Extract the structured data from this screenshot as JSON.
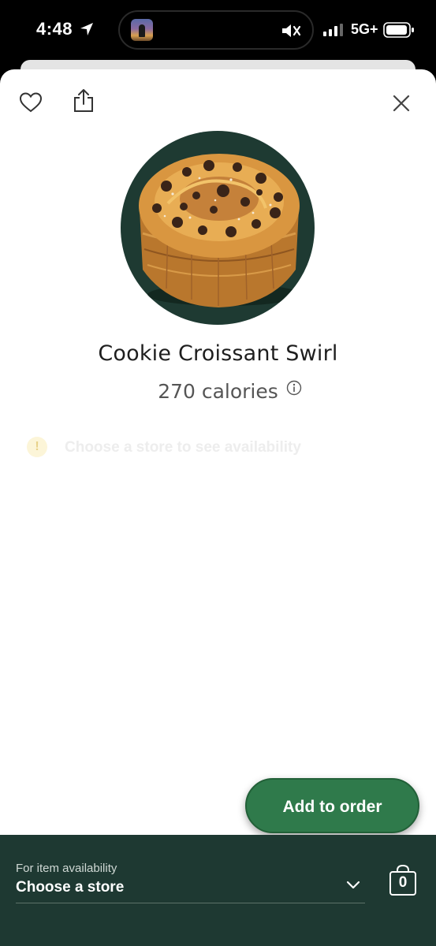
{
  "status_bar": {
    "time": "4:48",
    "network": "5G+",
    "icons": [
      "location-arrow-icon",
      "now-playing-artwork",
      "bell-muted-icon",
      "signal-icon",
      "battery-icon"
    ]
  },
  "header": {
    "icons": [
      "heart-icon",
      "share-icon",
      "close-icon"
    ]
  },
  "product": {
    "name": "Cookie Croissant Swirl",
    "calories": "270 calories",
    "image": "cookie-croissant-swirl-photo"
  },
  "availability": {
    "message": "Choose a store to see availability",
    "icon": "exclamation-icon"
  },
  "actions": {
    "add_to_order": "Add to order"
  },
  "store_bar": {
    "hint": "For item availability",
    "value": "Choose a store",
    "cart_count": "0"
  },
  "colors": {
    "brand_green": "#1e3932",
    "button_green": "#2f7a4b",
    "text_dark": "#1e1e1e",
    "text_muted": "#555555"
  }
}
